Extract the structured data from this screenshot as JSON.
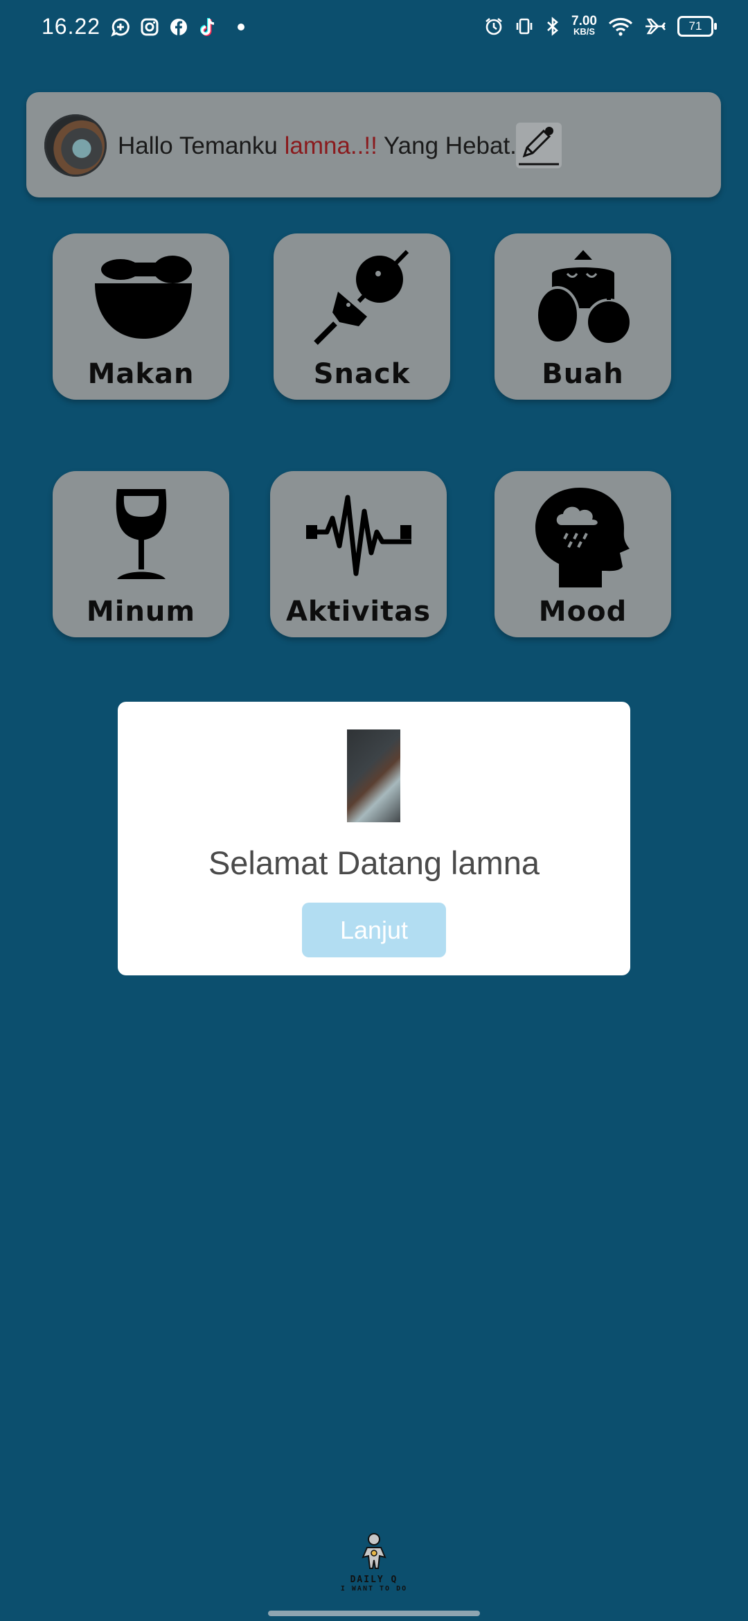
{
  "status_bar": {
    "time": "16.22",
    "left_icons": [
      "message-plus-icon",
      "instagram-icon",
      "facebook-icon",
      "tiktok-icon",
      "dot-icon"
    ],
    "right_icons": [
      "alarm-icon",
      "vibrate-icon",
      "bluetooth-icon",
      "network-speed",
      "wifi-icon",
      "airplane-icon",
      "battery-icon"
    ],
    "speed_value": "7.00",
    "speed_unit": "KB/S",
    "battery": "71"
  },
  "header": {
    "greeting_prefix": "Hallo Temanku ",
    "user_name": "lamna..!!",
    "greeting_suffix": " Yang Hebat..",
    "name_color": "#8a1a1d",
    "edit_icon": "pencil-edit-icon"
  },
  "categories": [
    {
      "label": "Makan",
      "icon": "bowl-spoon-icon"
    },
    {
      "label": "Snack",
      "icon": "skewer-icon"
    },
    {
      "label": "Buah",
      "icon": "fruit-basket-icon"
    },
    {
      "label": "Minum",
      "icon": "wine-glass-icon"
    },
    {
      "label": "Aktivitas",
      "icon": "pulse-wave-icon"
    },
    {
      "label": "Mood",
      "icon": "head-rain-cloud-icon"
    }
  ],
  "dialog": {
    "title": "Selamat Datang lamna",
    "button_label": "Lanjut",
    "button_color": "#b2ddf2"
  },
  "logo": {
    "line1": "DAILY Q",
    "line2": "I WANT TO DO"
  },
  "colors": {
    "background": "#0c4f6e",
    "card": "#8c9294"
  }
}
